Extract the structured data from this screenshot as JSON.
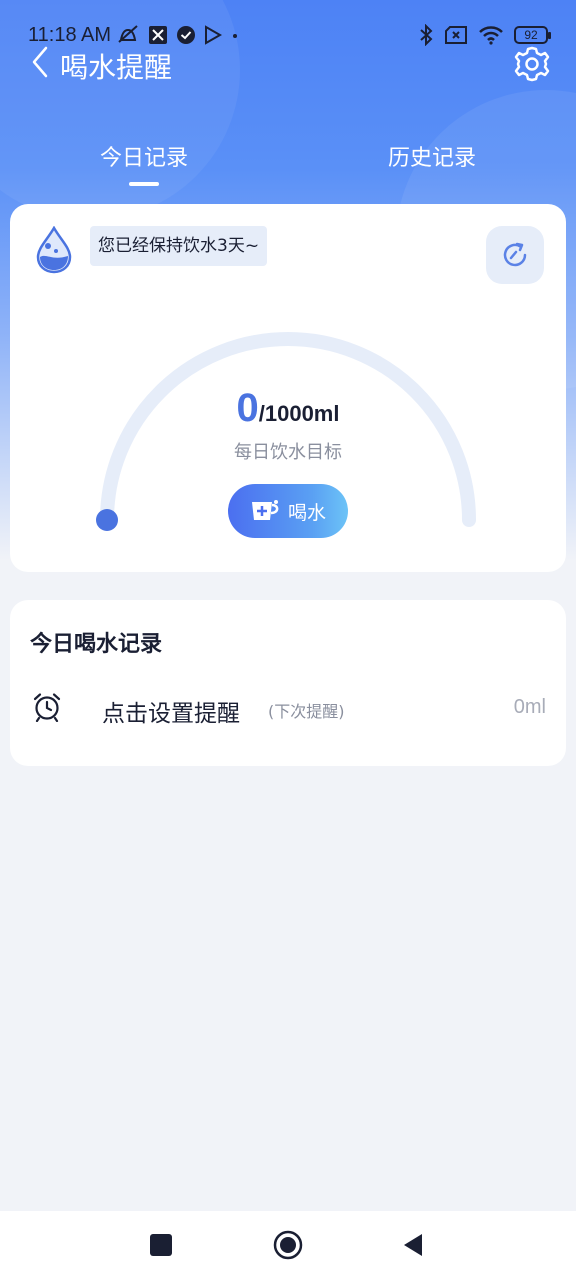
{
  "status_bar": {
    "time": "11:18 AM",
    "battery": "92"
  },
  "header": {
    "title": "喝水提醒"
  },
  "tabs": {
    "today": "今日记录",
    "history": "历史记录"
  },
  "main_card": {
    "streak_text": "您已经保持饮水3天~",
    "current_amount": "0",
    "goal": "/1000ml",
    "goal_caption": "每日饮水目标",
    "drink_button": "喝水",
    "progress_fraction": 0
  },
  "records_card": {
    "title": "今日喝水记录",
    "reminder_label": "点击设置提醒",
    "reminder_hint": "(下次提醒)",
    "reminder_amount": "0ml"
  },
  "colors": {
    "accent": "#4a73e0",
    "header_gradient_top": "#4d82f5",
    "track": "#e6edf9"
  }
}
